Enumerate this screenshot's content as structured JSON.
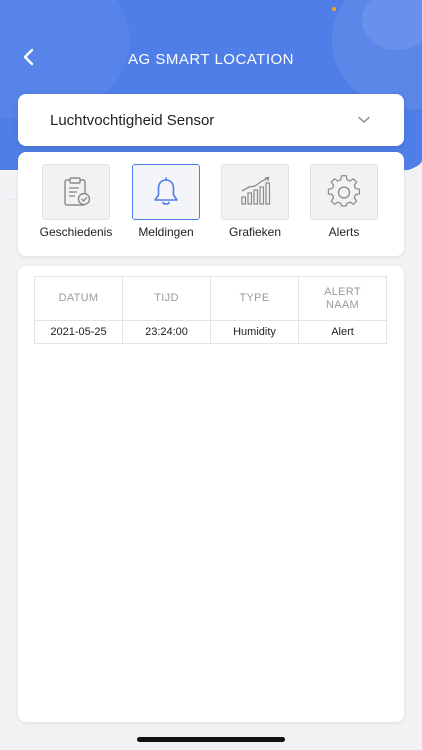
{
  "header": {
    "title": "AG SMART LOCATION"
  },
  "sensor": {
    "selected": "Luchtvochtigheid Sensor"
  },
  "tabs": [
    {
      "label": "Geschiedenis",
      "icon": "clipboard-check-icon",
      "active": false
    },
    {
      "label": "Meldingen",
      "icon": "bell-icon",
      "active": true
    },
    {
      "label": "Grafieken",
      "icon": "bar-chart-icon",
      "active": false
    },
    {
      "label": "Alerts",
      "icon": "gear-icon",
      "active": false
    }
  ],
  "table": {
    "headers": [
      "DATUM",
      "TIJD",
      "TYPE",
      "ALERT NAAM"
    ],
    "rows": [
      [
        "2021-05-25",
        "23:24:00",
        "Humidity",
        "Alert"
      ]
    ]
  },
  "colors": {
    "accent": "#4f7ee8",
    "background": "#f2f2f4",
    "header_text": "#9a9a9a"
  }
}
